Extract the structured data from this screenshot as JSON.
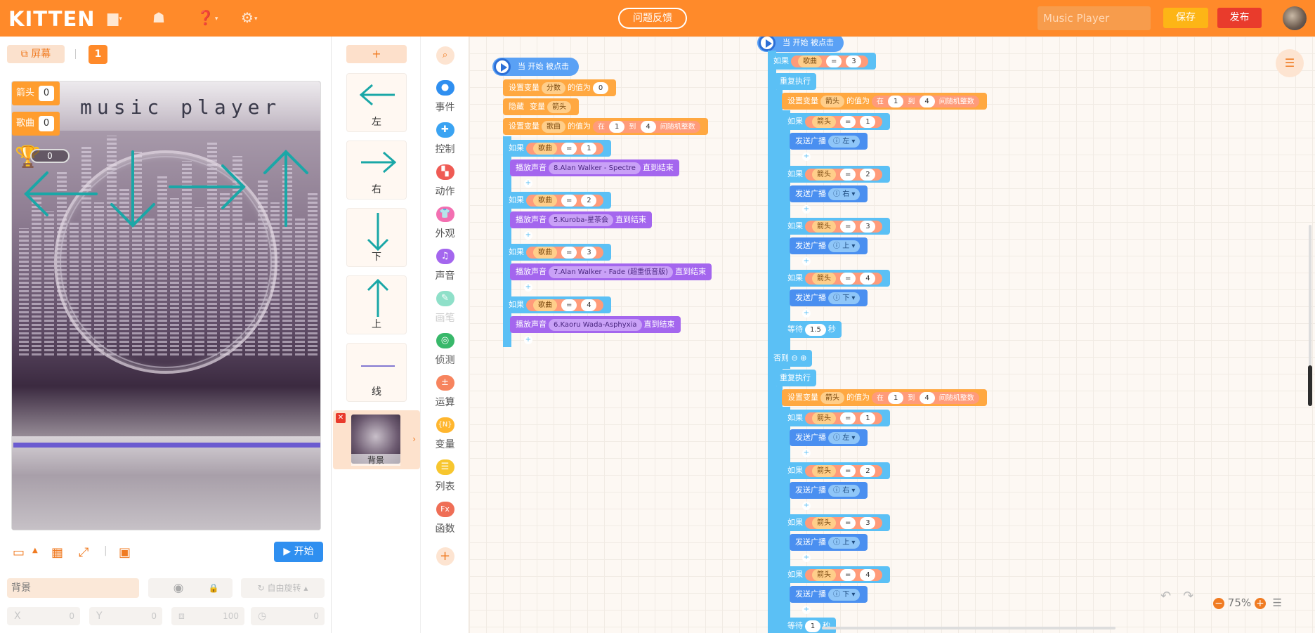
{
  "app": {
    "logo": "KITTEN",
    "feedback": "问题反馈",
    "project_name": "Music Player",
    "save": "保存",
    "publish": "发布"
  },
  "topbar_icons": [
    "folder-icon",
    "backpack-icon",
    "help-icon",
    "settings-icon"
  ],
  "stage": {
    "screen_tab": "屏幕",
    "scene_number": "1",
    "title_text": "music player",
    "variables": [
      {
        "name": "箭头",
        "value": "0"
      },
      {
        "name": "歌曲",
        "value": "0"
      }
    ],
    "trophy_count": "0",
    "start_button": "开始"
  },
  "properties": {
    "name": "背景",
    "rotate_label": "自由旋转",
    "x_label": "X",
    "x_value": "0",
    "y_label": "Y",
    "y_value": "0",
    "size_value": "100",
    "direction_value": "0"
  },
  "sprites": {
    "add": "+",
    "items": [
      {
        "label": "左",
        "arrow": "left"
      },
      {
        "label": "右",
        "arrow": "right"
      },
      {
        "label": "下",
        "arrow": "down"
      },
      {
        "label": "上",
        "arrow": "up"
      },
      {
        "label": "线",
        "arrow": "line"
      }
    ],
    "background_label": "背景"
  },
  "categories": [
    {
      "label": "事件",
      "color": "#2f8ff0"
    },
    {
      "label": "控制",
      "color": "#3aa3f2"
    },
    {
      "label": "动作",
      "color": "#ef5b54"
    },
    {
      "label": "外观",
      "color": "#f36fb1"
    },
    {
      "label": "声音",
      "color": "#a466ee"
    },
    {
      "label": "画笔",
      "color": "#8fe0c9"
    },
    {
      "label": "侦测",
      "color": "#38b86a"
    },
    {
      "label": "运算",
      "color": "#f7845e"
    },
    {
      "label": "变量",
      "color": "#ffb62e"
    },
    {
      "label": "列表",
      "color": "#f7c62e"
    },
    {
      "label": "函数",
      "color": "#ef6e56"
    }
  ],
  "script1": {
    "hat": "当 开始 被点击",
    "set_score": {
      "a": "设置变量",
      "var": "分数",
      "b": "的值为",
      "val": "0"
    },
    "hide_var": {
      "a": "隐藏",
      "b": "变量",
      "var": "箭头"
    },
    "set_song": {
      "a": "设置变量",
      "var": "歌曲",
      "b": "的值为",
      "c": "在",
      "from": "1",
      "d": "到",
      "to": "4",
      "e": "间随机整数"
    },
    "ifs": [
      {
        "if": "如果",
        "var": "歌曲",
        "op": "=",
        "val": "1",
        "play": "播放声音",
        "sound": "8.Alan Walker - Spectre",
        "until": "直到结束"
      },
      {
        "if": "如果",
        "var": "歌曲",
        "op": "=",
        "val": "2",
        "play": "播放声音",
        "sound": "5.Kuroba-星茶会",
        "until": "直到结束"
      },
      {
        "if": "如果",
        "var": "歌曲",
        "op": "=",
        "val": "3",
        "play": "播放声音",
        "sound": "7.Alan Walker - Fade (超重低音版)",
        "until": "直到结束"
      },
      {
        "if": "如果",
        "var": "歌曲",
        "op": "=",
        "val": "4",
        "play": "播放声音",
        "sound": "6.Kaoru Wada-Asphyxia",
        "until": "直到结束"
      }
    ]
  },
  "script2": {
    "hat": "当 开始 被点击",
    "if": "如果",
    "cond_var": "歌曲",
    "op": "=",
    "cond_val": "3",
    "repeat": "重复执行",
    "set_arrow": {
      "a": "设置变量",
      "var": "箭头",
      "b": "的值为",
      "c": "在",
      "from": "1",
      "d": "到",
      "to": "4",
      "e": "间随机整数"
    },
    "arrow_ifs": [
      {
        "var": "箭头",
        "val": "1",
        "send": "发送广播",
        "msg": "左"
      },
      {
        "var": "箭头",
        "val": "2",
        "send": "发送广播",
        "msg": "右"
      },
      {
        "var": "箭头",
        "val": "3",
        "send": "发送广播",
        "msg": "上"
      },
      {
        "var": "箭头",
        "val": "4",
        "send": "发送广播",
        "msg": "下"
      }
    ],
    "wait1": {
      "a": "等待",
      "val": "1.5",
      "b": "秒"
    },
    "else": "否则",
    "wait2": {
      "a": "等待",
      "val": "1",
      "b": "秒"
    }
  },
  "workspace": {
    "zoom": "75%"
  }
}
